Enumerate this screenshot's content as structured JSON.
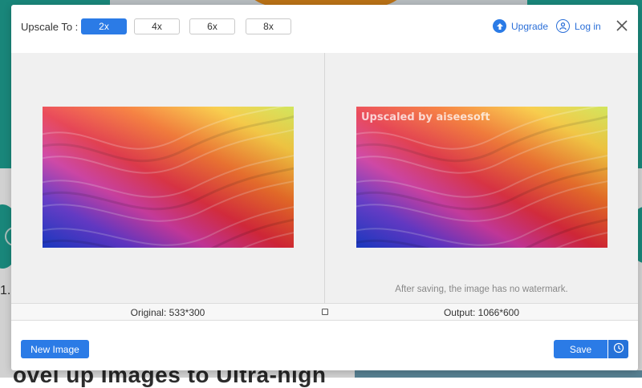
{
  "header": {
    "upscale_label": "Upscale To :",
    "scale_options": [
      "2x",
      "4x",
      "6x",
      "8x"
    ],
    "selected_scale": "2x",
    "upgrade_label": "Upgrade",
    "login_label": "Log in"
  },
  "preview": {
    "watermark_text": "Upscaled by aiseesoft",
    "note": "After saving, the image has no watermark."
  },
  "info": {
    "original": "Original: 533*300",
    "output": "Output: 1066*600"
  },
  "footer": {
    "new_image_label": "New Image",
    "save_label": "Save"
  },
  "background": {
    "list_number": "1.",
    "headline_fragment": "ovel up Images to Ultra-high"
  },
  "colors": {
    "accent": "#2b7be6",
    "background_teal": "#1fa495"
  },
  "icons": [
    "upgrade-icon",
    "user-icon",
    "close-icon",
    "compare-icon",
    "history-icon"
  ]
}
